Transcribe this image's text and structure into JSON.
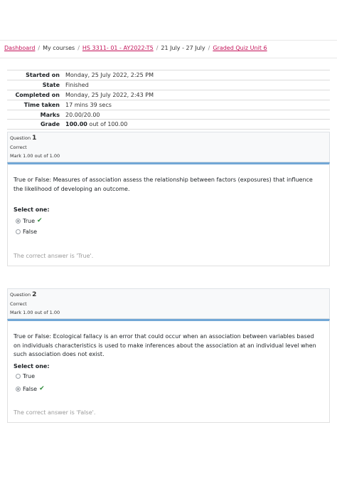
{
  "breadcrumb": [
    {
      "label": "Dashboard",
      "link": true
    },
    {
      "label": "My courses",
      "link": false
    },
    {
      "label": "HS 3311- 01 - AY2022-T5",
      "link": true
    },
    {
      "label": "21 July - 27 July",
      "link": false
    },
    {
      "label": "Graded Quiz Unit 6",
      "link": true
    }
  ],
  "summary": {
    "started_on": {
      "label": "Started on",
      "value": "Monday, 25 July 2022, 2:25 PM"
    },
    "state": {
      "label": "State",
      "value": "Finished"
    },
    "completed_on": {
      "label": "Completed on",
      "value": "Monday, 25 July 2022, 2:43 PM"
    },
    "time_taken": {
      "label": "Time taken",
      "value": "17 mins 39 secs"
    },
    "marks": {
      "label": "Marks",
      "value": "20.00/20.00"
    },
    "grade": {
      "label": "Grade",
      "value_bold": "100.00",
      "value_rest": " out of 100.00"
    }
  },
  "questions": [
    {
      "prefix": "Question ",
      "number": "1",
      "state": "Correct",
      "mark": "Mark 1.00 out of 1.00",
      "text": "True or False: Measures of association assess the relationship between factors (exposures) that influence the likelihood of developing an outcome.",
      "prompt": "Select one:",
      "options": [
        {
          "label": "True",
          "checked": true,
          "correct_mark": true
        },
        {
          "label": "False",
          "checked": false,
          "correct_mark": false
        }
      ],
      "correct_answer": "The correct answer is 'True'."
    },
    {
      "prefix": "Question ",
      "number": "2",
      "state": "Correct",
      "mark": "Mark 1.00 out of 1.00",
      "text": "True or False: Ecological fallacy is an error that could occur when an association between variables based on individuals characteristics is used to make inferences about the association at an individual level when such association does not exist.",
      "prompt": "Select one:",
      "options": [
        {
          "label": "True",
          "checked": false,
          "correct_mark": false
        },
        {
          "label": "False",
          "checked": true,
          "correct_mark": true
        }
      ],
      "correct_answer": "The correct answer is 'False'."
    }
  ],
  "icons": {
    "check": "check-icon",
    "radio": "radio-icon"
  },
  "colors": {
    "link": "#c4145a",
    "accent_bar": "#72a7d6",
    "check": "#2e8b3a",
    "muted": "#9a9a9a"
  }
}
